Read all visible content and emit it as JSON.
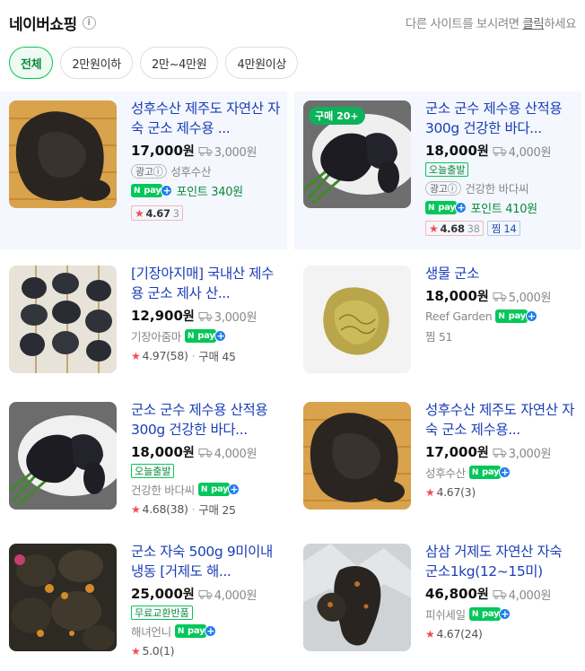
{
  "header": {
    "title": "네이버쇼핑",
    "info_icon": "info-icon",
    "link_prefix": "다른 사이트를 보시려면 ",
    "link_text": "클릭",
    "link_suffix": "하세요"
  },
  "filters": [
    {
      "label": "전체",
      "active": true
    },
    {
      "label": "2만원이하",
      "active": false
    },
    {
      "label": "2만~4만원",
      "active": false
    },
    {
      "label": "4만원이상",
      "active": false
    }
  ],
  "products": [
    {
      "title": "성후수산 제주도 자연산 자숙 군소 제수용 ...",
      "price": "17,000",
      "won": "원",
      "shipping": "3,000원",
      "ad_label": "광고ⓘ",
      "seller": "성후수산",
      "npay": "pay",
      "point_label": "포인트 340원",
      "rating": "4.67",
      "review_count": "3"
    },
    {
      "title": "군소 군수 제수용 산적용 300g 건강한 바다...",
      "price": "18,000",
      "won": "원",
      "shipping": "4,000원",
      "buy_badge": "구매 20+",
      "badge": "오늘출발",
      "ad_label": "광고ⓘ",
      "seller": "건강한 바다씨",
      "npay": "pay",
      "point_label": "포인트 410원",
      "rating": "4.68",
      "review_count": "38",
      "zzim": "찜 14"
    },
    {
      "title": "[기장아지매] 국내산 제수용 군소 제사 산...",
      "price": "12,900",
      "won": "원",
      "shipping": "3,000원",
      "seller": "기장아줌마",
      "npay": "pay",
      "rating": "4.97",
      "review_count": "(58)",
      "purchase": "구매 45"
    },
    {
      "title": "생물 군소",
      "price": "18,000",
      "won": "원",
      "shipping": "5,000원",
      "seller": "Reef Garden",
      "npay": "pay",
      "zzim": "찜 51"
    },
    {
      "title": "군소 군수 제수용 산적용 300g 건강한 바다...",
      "price": "18,000",
      "won": "원",
      "shipping": "4,000원",
      "badge": "오늘출발",
      "seller": "건강한 바다씨",
      "npay": "pay",
      "rating": "4.68",
      "review_count": "(38)",
      "purchase": "구매 25"
    },
    {
      "title": "성후수산 제주도 자연산 자숙 군소 제수용...",
      "price": "17,000",
      "won": "원",
      "shipping": "3,000원",
      "seller": "성후수산",
      "npay": "pay",
      "rating": "4.67",
      "review_count": "(3)"
    },
    {
      "title": "군소 자숙 500g 9미이내 냉동 [거제도 해...",
      "price": "25,000",
      "won": "원",
      "shipping": "4,000원",
      "badge": "무료교환반품",
      "seller": "해녀언니",
      "npay": "pay",
      "rating": "5.0",
      "review_count": "(1)"
    },
    {
      "title": "삼삼 거제도 자연산 자숙 군소1kg(12~15미)",
      "price": "46,800",
      "won": "원",
      "shipping": "4,000원",
      "seller": "피쉬세일",
      "npay": "pay",
      "rating": "4.67",
      "review_count": "(24)"
    }
  ],
  "colors": {
    "accent": "#03c75a",
    "link": "#1a3eb8",
    "star": "#f24d4d",
    "ad_bg": "#f4f7fd"
  }
}
